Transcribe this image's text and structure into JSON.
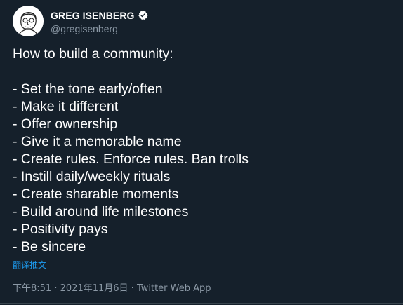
{
  "author": {
    "display_name": "GREG ISENBERG",
    "handle": "@gregisenberg",
    "verified": true,
    "avatar_icon": "sketch-portrait-avatar"
  },
  "tweet": {
    "lines": [
      "How to build a community:",
      "",
      "- Set the tone early/often",
      "- Make it different",
      "- Offer ownership",
      "- Give it a memorable name",
      "- Create rules. Enforce rules. Ban trolls",
      "- Instill daily/weekly rituals",
      "- Create sharable moments",
      "- Build around life milestones",
      "- Positivity pays",
      "- Be sincere"
    ],
    "translate_label": "翻译推文",
    "time": "下午8:51",
    "date": "2021年11月6日",
    "separator": "·",
    "source": "Twitter Web App"
  },
  "colors": {
    "background": "#15202b",
    "text": "#ffffff",
    "secondary_text": "#8b98a5",
    "accent": "#1d9bf0",
    "divider": "#38444d"
  }
}
